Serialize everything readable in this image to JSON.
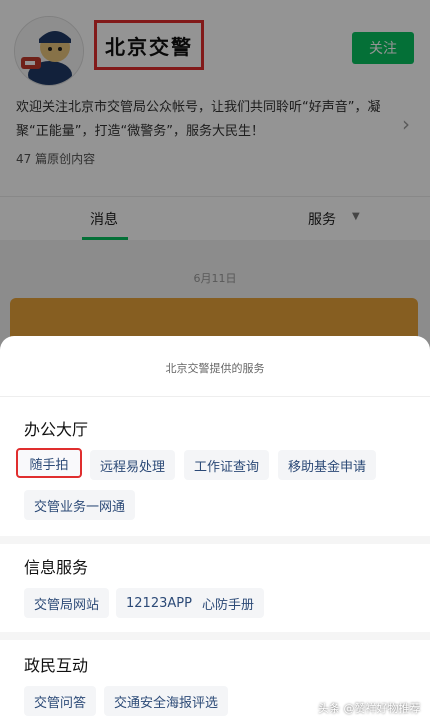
{
  "profile": {
    "name": "北京交警",
    "follow_label": "关注",
    "intro": "欢迎关注北京市交管局公众帐号，让我们共同聆听“好声音”，凝聚“正能量”，打造“微警务”，服务大民生！",
    "article_count": "47 篇原创内容",
    "tabs": [
      "消息",
      "服务"
    ],
    "date_label": "6月11日"
  },
  "sheet": {
    "title": "北京交警提供的服务",
    "sections": [
      {
        "title": "办公大厅",
        "items": [
          "随手拍",
          "远程易处理",
          "工作证查询",
          "移助基金申请",
          "交管业务一网通"
        ]
      },
      {
        "title": "信息服务",
        "items": [
          "交管局网站",
          "12123APP",
          "心防手册"
        ]
      },
      {
        "title": "政民互动",
        "items": [
          "交管问答",
          "交通安全海报评选"
        ]
      }
    ]
  },
  "watermark": "头条 @赞祥好物推荐",
  "colors": {
    "accent": "#07c160",
    "highlight": "#e02e2e",
    "chip_text": "#2c4a77"
  },
  "icons": {
    "avatar": "police-mascot-avatar",
    "intro_arrow": "chevron-right-icon",
    "service_tab": "chevron-down-icon"
  }
}
